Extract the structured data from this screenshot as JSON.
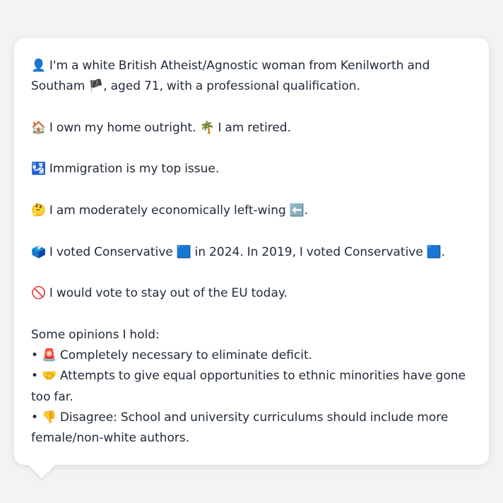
{
  "profile": {
    "intro": {
      "icon": "👤",
      "text_a": "I'm a white British Atheist/Agnostic woman from Kenilworth and Southam",
      "flag": "🏴",
      "text_b": ", aged 71, with a professional qualification."
    },
    "home": {
      "icon": "🏠",
      "text_a": "I own my home outright.",
      "icon2": "🌴",
      "text_b": "I am retired."
    },
    "issue": {
      "icon": "🛂",
      "text": "Immigration is my top issue."
    },
    "economics": {
      "icon": "🤔",
      "text": "I am moderately economically left-wing",
      "icon2": "⬅️",
      "suffix": "."
    },
    "vote": {
      "icon": "🗳️",
      "text_a": "I voted Conservative",
      "square": "🟦",
      "text_b": "in 2024. In 2019, I voted Conservative",
      "square2": "🟦",
      "suffix": "."
    },
    "eu": {
      "icon": "🚫",
      "text": "I would vote to stay out of the EU today."
    },
    "opinions_heading": "Some opinions I hold:",
    "opinions": [
      {
        "bullet": "•",
        "icon": "🚨",
        "text": "Completely necessary to eliminate deficit."
      },
      {
        "bullet": "•",
        "icon": "🤝",
        "text": "Attempts to give equal opportunities to ethnic minorities have gone too far."
      },
      {
        "bullet": "•",
        "icon": "👎",
        "text": "Disagree: School and university curriculums should include more female/non-white authors."
      }
    ]
  }
}
